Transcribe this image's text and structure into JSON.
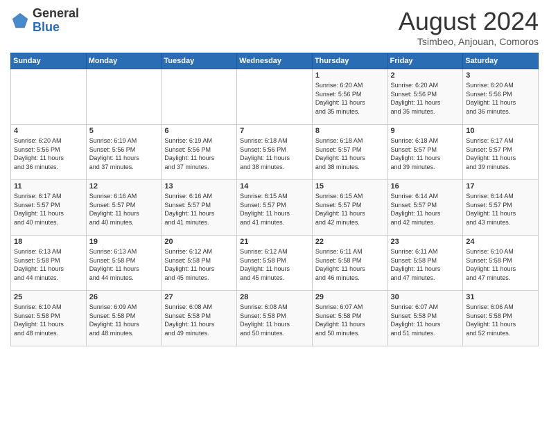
{
  "header": {
    "logo_general": "General",
    "logo_blue": "Blue",
    "month_title": "August 2024",
    "subtitle": "Tsimbeo, Anjouan, Comoros"
  },
  "days_of_week": [
    "Sunday",
    "Monday",
    "Tuesday",
    "Wednesday",
    "Thursday",
    "Friday",
    "Saturday"
  ],
  "weeks": [
    [
      {
        "day": "",
        "text": ""
      },
      {
        "day": "",
        "text": ""
      },
      {
        "day": "",
        "text": ""
      },
      {
        "day": "",
        "text": ""
      },
      {
        "day": "1",
        "text": "Sunrise: 6:20 AM\nSunset: 5:56 PM\nDaylight: 11 hours\nand 35 minutes."
      },
      {
        "day": "2",
        "text": "Sunrise: 6:20 AM\nSunset: 5:56 PM\nDaylight: 11 hours\nand 35 minutes."
      },
      {
        "day": "3",
        "text": "Sunrise: 6:20 AM\nSunset: 5:56 PM\nDaylight: 11 hours\nand 36 minutes."
      }
    ],
    [
      {
        "day": "4",
        "text": "Sunrise: 6:20 AM\nSunset: 5:56 PM\nDaylight: 11 hours\nand 36 minutes."
      },
      {
        "day": "5",
        "text": "Sunrise: 6:19 AM\nSunset: 5:56 PM\nDaylight: 11 hours\nand 37 minutes."
      },
      {
        "day": "6",
        "text": "Sunrise: 6:19 AM\nSunset: 5:56 PM\nDaylight: 11 hours\nand 37 minutes."
      },
      {
        "day": "7",
        "text": "Sunrise: 6:18 AM\nSunset: 5:56 PM\nDaylight: 11 hours\nand 38 minutes."
      },
      {
        "day": "8",
        "text": "Sunrise: 6:18 AM\nSunset: 5:57 PM\nDaylight: 11 hours\nand 38 minutes."
      },
      {
        "day": "9",
        "text": "Sunrise: 6:18 AM\nSunset: 5:57 PM\nDaylight: 11 hours\nand 39 minutes."
      },
      {
        "day": "10",
        "text": "Sunrise: 6:17 AM\nSunset: 5:57 PM\nDaylight: 11 hours\nand 39 minutes."
      }
    ],
    [
      {
        "day": "11",
        "text": "Sunrise: 6:17 AM\nSunset: 5:57 PM\nDaylight: 11 hours\nand 40 minutes."
      },
      {
        "day": "12",
        "text": "Sunrise: 6:16 AM\nSunset: 5:57 PM\nDaylight: 11 hours\nand 40 minutes."
      },
      {
        "day": "13",
        "text": "Sunrise: 6:16 AM\nSunset: 5:57 PM\nDaylight: 11 hours\nand 41 minutes."
      },
      {
        "day": "14",
        "text": "Sunrise: 6:15 AM\nSunset: 5:57 PM\nDaylight: 11 hours\nand 41 minutes."
      },
      {
        "day": "15",
        "text": "Sunrise: 6:15 AM\nSunset: 5:57 PM\nDaylight: 11 hours\nand 42 minutes."
      },
      {
        "day": "16",
        "text": "Sunrise: 6:14 AM\nSunset: 5:57 PM\nDaylight: 11 hours\nand 42 minutes."
      },
      {
        "day": "17",
        "text": "Sunrise: 6:14 AM\nSunset: 5:57 PM\nDaylight: 11 hours\nand 43 minutes."
      }
    ],
    [
      {
        "day": "18",
        "text": "Sunrise: 6:13 AM\nSunset: 5:58 PM\nDaylight: 11 hours\nand 44 minutes."
      },
      {
        "day": "19",
        "text": "Sunrise: 6:13 AM\nSunset: 5:58 PM\nDaylight: 11 hours\nand 44 minutes."
      },
      {
        "day": "20",
        "text": "Sunrise: 6:12 AM\nSunset: 5:58 PM\nDaylight: 11 hours\nand 45 minutes."
      },
      {
        "day": "21",
        "text": "Sunrise: 6:12 AM\nSunset: 5:58 PM\nDaylight: 11 hours\nand 45 minutes."
      },
      {
        "day": "22",
        "text": "Sunrise: 6:11 AM\nSunset: 5:58 PM\nDaylight: 11 hours\nand 46 minutes."
      },
      {
        "day": "23",
        "text": "Sunrise: 6:11 AM\nSunset: 5:58 PM\nDaylight: 11 hours\nand 47 minutes."
      },
      {
        "day": "24",
        "text": "Sunrise: 6:10 AM\nSunset: 5:58 PM\nDaylight: 11 hours\nand 47 minutes."
      }
    ],
    [
      {
        "day": "25",
        "text": "Sunrise: 6:10 AM\nSunset: 5:58 PM\nDaylight: 11 hours\nand 48 minutes."
      },
      {
        "day": "26",
        "text": "Sunrise: 6:09 AM\nSunset: 5:58 PM\nDaylight: 11 hours\nand 48 minutes."
      },
      {
        "day": "27",
        "text": "Sunrise: 6:08 AM\nSunset: 5:58 PM\nDaylight: 11 hours\nand 49 minutes."
      },
      {
        "day": "28",
        "text": "Sunrise: 6:08 AM\nSunset: 5:58 PM\nDaylight: 11 hours\nand 50 minutes."
      },
      {
        "day": "29",
        "text": "Sunrise: 6:07 AM\nSunset: 5:58 PM\nDaylight: 11 hours\nand 50 minutes."
      },
      {
        "day": "30",
        "text": "Sunrise: 6:07 AM\nSunset: 5:58 PM\nDaylight: 11 hours\nand 51 minutes."
      },
      {
        "day": "31",
        "text": "Sunrise: 6:06 AM\nSunset: 5:58 PM\nDaylight: 11 hours\nand 52 minutes."
      }
    ]
  ]
}
